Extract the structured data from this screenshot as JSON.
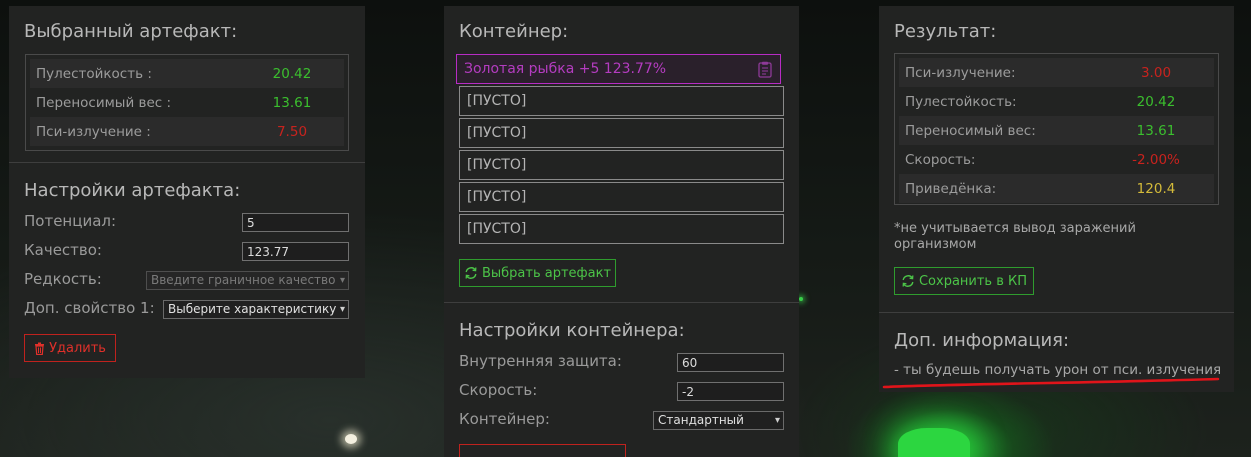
{
  "colors": {
    "panel_bg": "#222322",
    "positive": "#3bbf2e",
    "negative": "#c8231e",
    "warning": "#d4bb3a",
    "filled_slot": "#b43cc0",
    "accent_green": "#4cc448",
    "accent_red": "#e0302a"
  },
  "left": {
    "heading": "Выбранный артефакт:",
    "stats": [
      {
        "label": "Пулестойкость :",
        "value": "20.42",
        "tone": "positive"
      },
      {
        "label": "Переносимый вес :",
        "value": "13.61",
        "tone": "positive"
      },
      {
        "label": "Пси-излучение :",
        "value": "7.50",
        "tone": "negative"
      }
    ],
    "settings_heading": "Настройки артефакта:",
    "potential_label": "Потенциал:",
    "potential_value": "5",
    "quality_label": "Качество:",
    "quality_value": "123.77",
    "rarity_label": "Редкость:",
    "rarity_select": "Введите граничное качество",
    "extra_label": "Доп. свойство 1:",
    "extra_select": "Выберите характеристику",
    "delete_button": "Удалить",
    "delete_icon": "trash-icon"
  },
  "center": {
    "heading": "Контейнер:",
    "slots": [
      {
        "text": "Золотая рыбка +5 123.77%",
        "filled": true,
        "icon": "clipboard-icon"
      },
      {
        "text": "[ПУСТО]",
        "filled": false
      },
      {
        "text": "[ПУСТО]",
        "filled": false
      },
      {
        "text": "[ПУСТО]",
        "filled": false
      },
      {
        "text": "[ПУСТО]",
        "filled": false
      },
      {
        "text": "[ПУСТО]",
        "filled": false
      }
    ],
    "select_button": "Выбрать артефакт",
    "select_icon": "refresh-icon",
    "settings_heading": "Настройки контейнера:",
    "protection_label": "Внутренняя защита:",
    "protection_value": "60",
    "speed_label": "Скорость:",
    "speed_value": "-2",
    "container_label": "Контейнер:",
    "container_select": "Стандартный"
  },
  "right": {
    "heading": "Результат:",
    "stats": [
      {
        "label": "Пси-излучение:",
        "value": "3.00",
        "tone": "negative"
      },
      {
        "label": "Пулестойкость:",
        "value": "20.42",
        "tone": "positive"
      },
      {
        "label": "Переносимый вес:",
        "value": "13.61",
        "tone": "positive"
      },
      {
        "label": "Скорость:",
        "value": "-2.00%",
        "tone": "negative"
      },
      {
        "label": "Приведёнка:",
        "value": "120.4",
        "tone": "warning"
      }
    ],
    "note": "*не учитывается вывод заражений организмом",
    "save_button": "Сохранить в КП",
    "save_icon": "refresh-icon",
    "info_heading": "Доп. информация:",
    "info_line": "- ты будешь получать урон от пси. излучения"
  }
}
